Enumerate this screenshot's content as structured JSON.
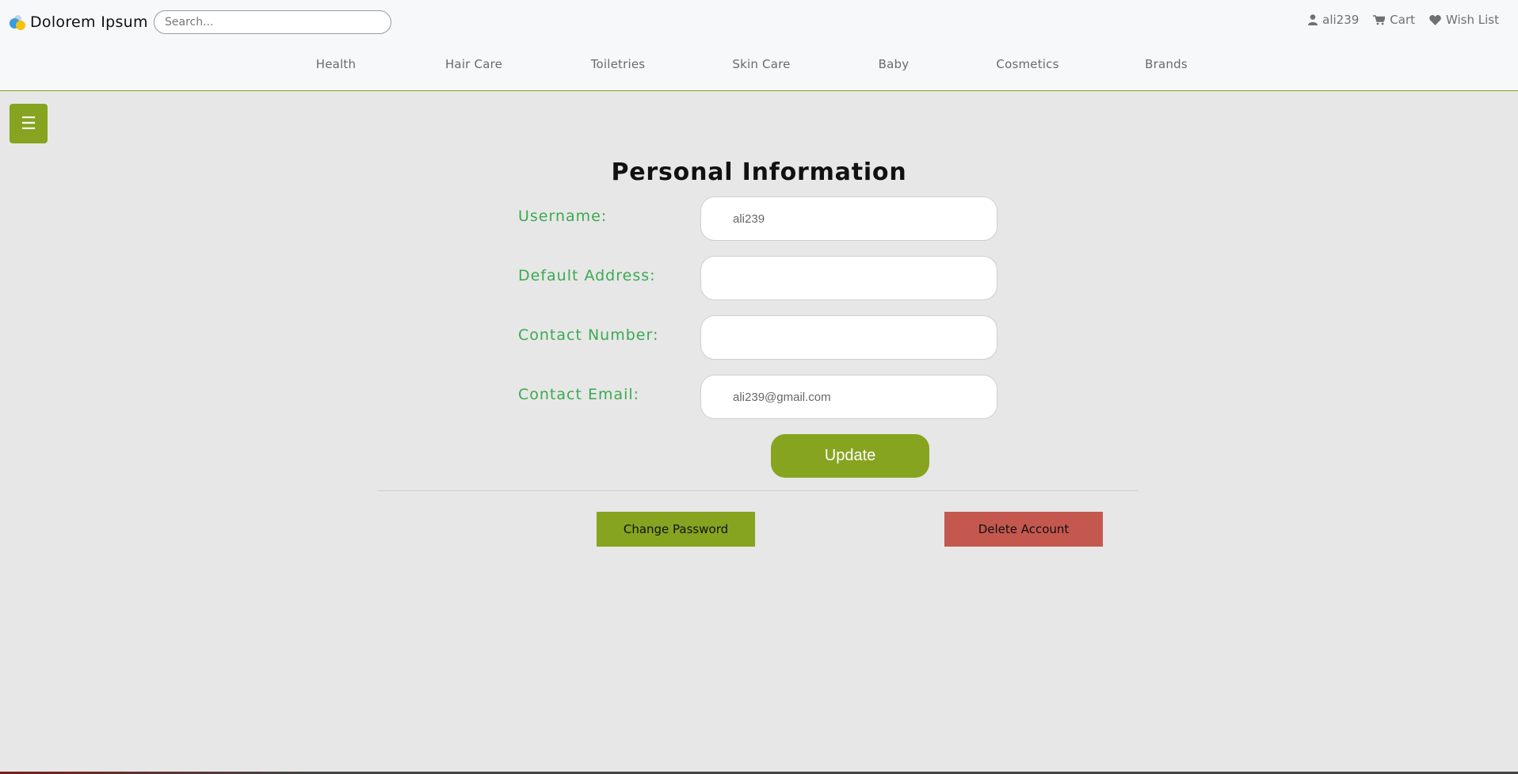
{
  "header": {
    "brand": "Dolorem Ipsum",
    "search_placeholder": "Search...",
    "user_links": [
      {
        "label": "ali239",
        "icon": "user-icon"
      },
      {
        "label": "Cart",
        "icon": "cart-icon"
      },
      {
        "label": "Wish List",
        "icon": "heart-icon"
      }
    ],
    "nav": [
      "Health",
      "Hair Care",
      "Toiletries",
      "Skin Care",
      "Baby",
      "Cosmetics",
      "Brands"
    ]
  },
  "menu_toggle": "☰",
  "main": {
    "title": "Personal Information",
    "fields": [
      {
        "label": "Username:",
        "value": "ali239"
      },
      {
        "label": "Default Address:",
        "value": ""
      },
      {
        "label": "Contact Number:",
        "value": ""
      },
      {
        "label": "Contact Email:",
        "value": "ali239@gmail.com"
      }
    ],
    "update_label": "Update",
    "change_password_label": "Change Password",
    "delete_account_label": "Delete Account"
  },
  "colors": {
    "accent": "#86a41f",
    "label_green": "#3aaa51",
    "danger": "#c4584e",
    "background": "#e7e7e7"
  }
}
